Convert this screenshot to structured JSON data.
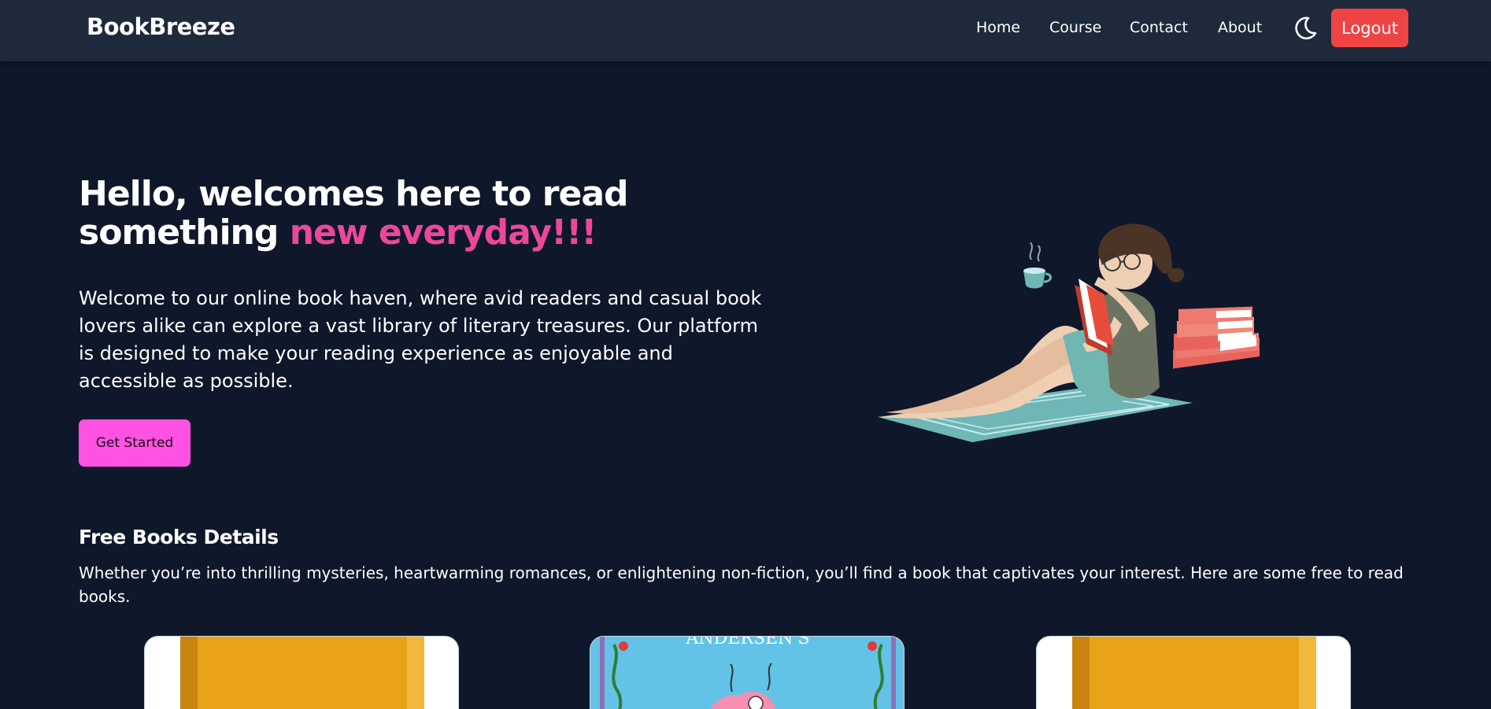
{
  "navbar": {
    "logo": "BookBreeze",
    "links": [
      "Home",
      "Course",
      "Contact",
      "About"
    ],
    "logout_label": "Logout",
    "theme_icon": "moon-icon"
  },
  "hero": {
    "title_line1": "Hello, welcomes here to read",
    "title_line2_plain": "something ",
    "title_line2_accent": "new everyday!!!",
    "description": "Welcome to our online book haven, where avid readers and casual book lovers alike can explore a vast library of literary treasures. Our platform is designed to make your reading experience as enjoyable and accessible as possible.",
    "cta_label": "Get Started",
    "illustration": "woman-reading-illustration"
  },
  "free_books": {
    "title": "Free Books Details",
    "description": "Whether you’re into thrilling mysteries, heartwarming romances, or enlightening non-fiction, you’ll find a book that captivates your interest. Here are some free to read books.",
    "cards": [
      {
        "cover": "orange-book-cover"
      },
      {
        "cover": "blue-illustrated-book-cover",
        "cover_text": "ANDERSEN'S"
      },
      {
        "cover": "orange-book-cover"
      }
    ]
  },
  "colors": {
    "background": "#0f172a",
    "navbar": "#1e293b",
    "accent_pink": "#ec4899",
    "cta_pink": "#ff52e3",
    "logout_red": "#ef4444"
  }
}
